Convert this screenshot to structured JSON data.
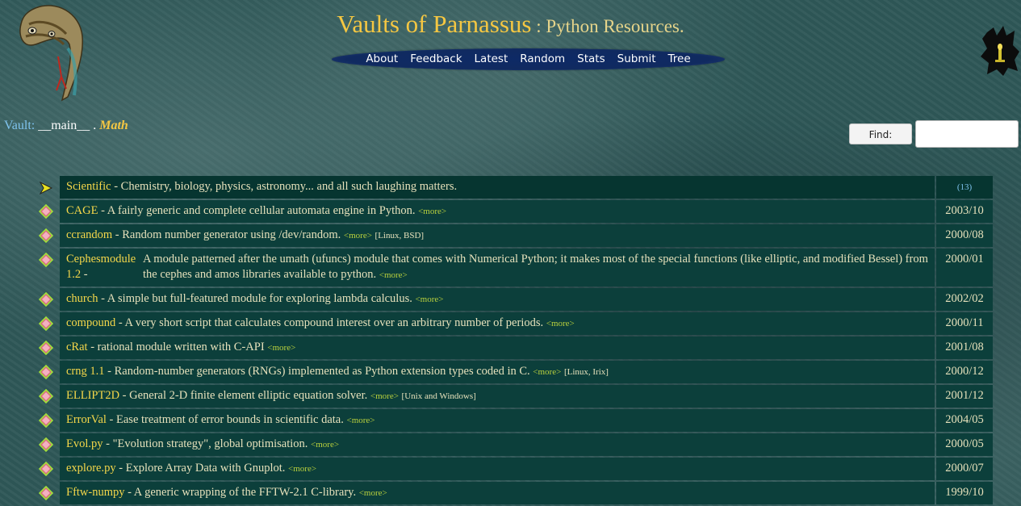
{
  "header": {
    "title": "Vaults of Parnassus",
    "separator": " : ",
    "subtitle": "Python Resources."
  },
  "nav": {
    "items": [
      {
        "label": "About"
      },
      {
        "label": "Feedback"
      },
      {
        "label": "Latest"
      },
      {
        "label": "Random"
      },
      {
        "label": "Stats"
      },
      {
        "label": "Submit"
      },
      {
        "label": "Tree"
      }
    ]
  },
  "breadcrumb": {
    "label": "Vault:",
    "path": "__main__",
    "sep": ".",
    "current": "Math"
  },
  "search": {
    "button_label": "Find:",
    "value": ""
  },
  "icons": {
    "category": "arrow-icon",
    "entry": "diamond-icon",
    "logo_left": "snake-logo",
    "logo_right": "lamp-icon"
  },
  "category": {
    "name": "Scientific",
    "desc": "Chemistry, biology, physics, astronomy... and all such laughing matters.",
    "count": "(13)"
  },
  "entries": [
    {
      "name": "CAGE",
      "desc": "A fairly generic and complete cellular automata engine in Python.",
      "more": "<more>",
      "platform": "",
      "date": "2003/10"
    },
    {
      "name": "ccrandom",
      "desc": "Random number generator using /dev/random.",
      "more": "<more>",
      "platform": "[Linux, BSD]",
      "date": "2000/08"
    },
    {
      "name": "Cephesmodule 1.2",
      "desc": "A module patterned after the umath (ufuncs) module that comes with Numerical Python; it makes most of the special functions (like elliptic, and modified Bessel) from the cephes and amos libraries available to python.",
      "more": "<more>",
      "platform": "",
      "date": "2000/01"
    },
    {
      "name": "church",
      "desc": "A simple but full-featured module for exploring lambda calculus.",
      "more": "<more>",
      "platform": "",
      "date": "2002/02"
    },
    {
      "name": "compound",
      "desc": "A very short script that calculates compound interest over an arbitrary number of periods.",
      "more": "<more>",
      "platform": "",
      "date": "2000/11"
    },
    {
      "name": "cRat",
      "desc": "rational module written with C-API",
      "more": "<more>",
      "platform": "",
      "date": "2001/08"
    },
    {
      "name": "crng 1.1",
      "desc": "Random-number generators (RNGs) implemented as Python extension types coded in C.",
      "more": "<more>",
      "platform": "[Linux, Irix]",
      "date": "2000/12"
    },
    {
      "name": "ELLIPT2D",
      "desc": "General 2-D finite element elliptic equation solver.",
      "more": "<more>",
      "platform": "[Unix and Windows]",
      "date": "2001/12"
    },
    {
      "name": "ErrorVal",
      "desc": "Ease treatment of error bounds in scientific data.",
      "more": "<more>",
      "platform": "",
      "date": "2004/05"
    },
    {
      "name": "Evol.py",
      "desc": "\"Evolution strategy\", global optimisation.",
      "more": "<more>",
      "platform": "",
      "date": "2000/05"
    },
    {
      "name": "explore.py",
      "desc": "Explore Array Data with Gnuplot.",
      "more": "<more>",
      "platform": "",
      "date": "2000/07"
    },
    {
      "name": "Fftw-numpy",
      "desc": "A generic wrapping of the FFTW-2.1 C-library.",
      "more": "<more>",
      "platform": "",
      "date": "1999/10"
    }
  ]
}
